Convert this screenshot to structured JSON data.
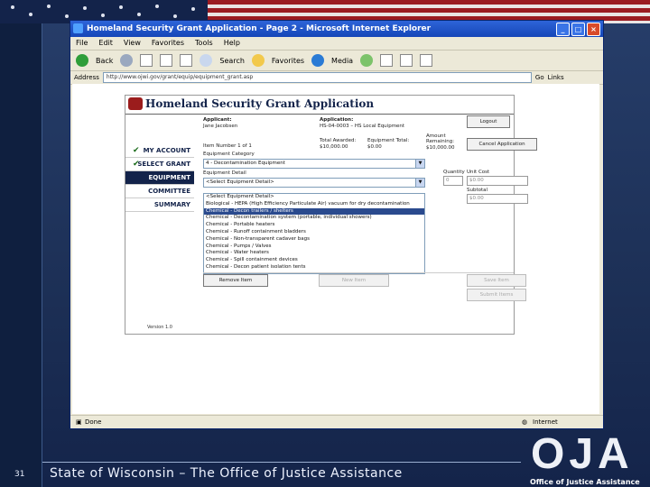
{
  "slide": {
    "number": "31",
    "footer": "State of Wisconsin – The Office of Justice Assistance",
    "logo_text": "OJA",
    "logo_subtitle": "Office of Justice Assistance"
  },
  "window": {
    "title": "Homeland Security Grant Application - Page 2 - Microsoft Internet Explorer",
    "menu": [
      "File",
      "Edit",
      "View",
      "Favorites",
      "Tools",
      "Help"
    ],
    "toolbar": {
      "back": "Back",
      "search": "Search",
      "favorites": "Favorites",
      "media": "Media"
    },
    "address_label": "Address",
    "address_value": "http://www.ojwi.gov/grant/equip/equipment_grant.asp",
    "go_label": "Go",
    "links_label": "Links",
    "status_left": "Done",
    "status_right": "Internet"
  },
  "app": {
    "title": "Homeland Security Grant Application",
    "nav": [
      {
        "label": "MY ACCOUNT",
        "checked": true
      },
      {
        "label": "SELECT GRANT",
        "checked": true
      },
      {
        "label": "EQUIPMENT",
        "active": true
      },
      {
        "label": "COMMITTEE"
      },
      {
        "label": "SUMMARY"
      }
    ],
    "version": "Version 1.0",
    "applicant_label": "Applicant:",
    "applicant_value": "Jane Jacobsen",
    "application_label": "Application:",
    "application_value": "HS-04-0003 – HS Local Equipment",
    "item_number": "Item Number 1 of 1",
    "total_awarded_label": "Total Awarded:",
    "total_awarded_value": "$10,000.00",
    "equip_total_label": "Equipment Total:",
    "equip_total_value": "$0.00",
    "amount_remaining_label": "Amount Remaining:",
    "amount_remaining_value": "$10,000.00",
    "category_label": "Equipment Category",
    "category_value": "4 - Decontamination Equipment",
    "detail_label": "Equipment Detail",
    "detail_value": "<Select Equipment Detail>",
    "quantity_label": "Quantity",
    "quantity_value": "0",
    "unit_cost_label": "Unit Cost",
    "unit_cost_value": "$0.00",
    "subtotal_label": "Subtotal",
    "subtotal_value": "$0.00",
    "logout_button": "Logout",
    "cancel_button": "Cancel Application",
    "remove_button": "Remove Item",
    "new_button": "New Item",
    "save_button": "Save Item",
    "submit_button": "Submit Items",
    "options": [
      "<Select Equipment Detail>",
      "Biological - HEPA (High Efficiency Particulate Air) vacuum for dry decontamination",
      "Chemical - Decon trailers / shelters",
      "Chemical - Decontamination system (portable, individual showers)",
      "Chemical - Portable heaters",
      "Chemical - Runoff containment bladders",
      "Chemical - Non-transparent cadaver bags",
      "Chemical - Pumps / Valves",
      "Chemical - Water heaters",
      "Chemical - Spill containment devices",
      "Chemical - Decon patient isolation tents"
    ],
    "selected_option_index": 2
  }
}
